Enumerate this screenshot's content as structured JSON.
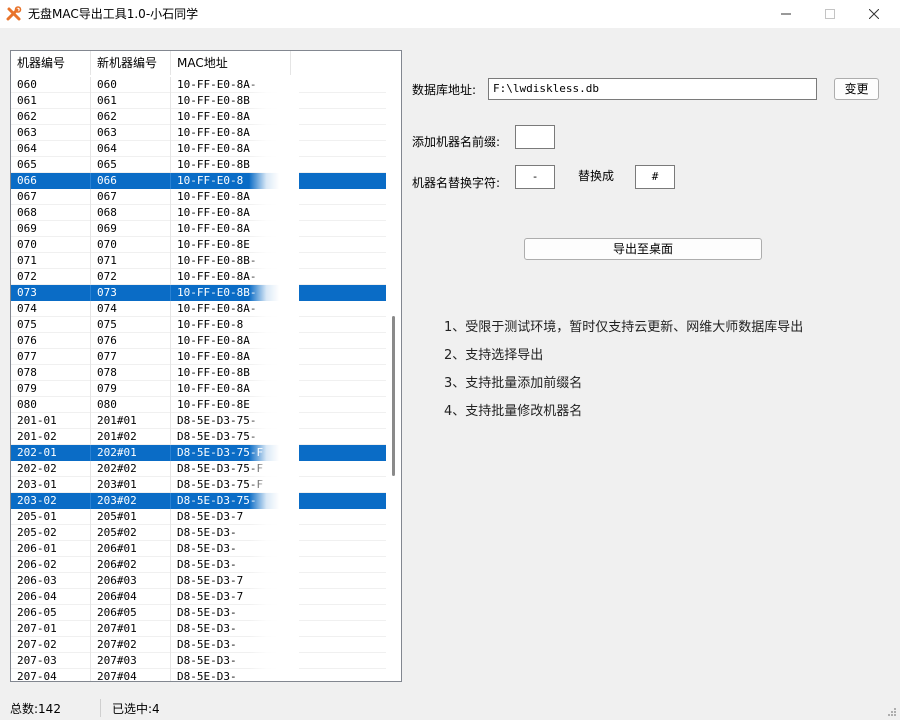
{
  "window": {
    "title": "无盘MAC导出工具1.0-小石同学",
    "controls": {
      "minimize": "—",
      "maximize": "☐",
      "close": "✕"
    }
  },
  "list": {
    "columns": [
      "机器编号",
      "新机器编号",
      "MAC地址"
    ],
    "rows": [
      {
        "id": "060",
        "new": "060",
        "mac": "10-FF-E0-8A-",
        "selected": false
      },
      {
        "id": "061",
        "new": "061",
        "mac": "10-FF-E0-8B",
        "selected": false
      },
      {
        "id": "062",
        "new": "062",
        "mac": "10-FF-E0-8A",
        "selected": false
      },
      {
        "id": "063",
        "new": "063",
        "mac": "10-FF-E0-8A",
        "selected": false
      },
      {
        "id": "064",
        "new": "064",
        "mac": "10-FF-E0-8A",
        "selected": false
      },
      {
        "id": "065",
        "new": "065",
        "mac": "10-FF-E0-8B",
        "selected": false
      },
      {
        "id": "066",
        "new": "066",
        "mac": "10-FF-E0-8",
        "selected": true
      },
      {
        "id": "067",
        "new": "067",
        "mac": "10-FF-E0-8A",
        "selected": false
      },
      {
        "id": "068",
        "new": "068",
        "mac": "10-FF-E0-8A",
        "selected": false
      },
      {
        "id": "069",
        "new": "069",
        "mac": "10-FF-E0-8A",
        "selected": false
      },
      {
        "id": "070",
        "new": "070",
        "mac": "10-FF-E0-8E",
        "selected": false
      },
      {
        "id": "071",
        "new": "071",
        "mac": "10-FF-E0-8B-",
        "selected": false
      },
      {
        "id": "072",
        "new": "072",
        "mac": "10-FF-E0-8A-",
        "selected": false
      },
      {
        "id": "073",
        "new": "073",
        "mac": "10-FF-E0-8B-",
        "selected": true
      },
      {
        "id": "074",
        "new": "074",
        "mac": "10-FF-E0-8A-",
        "selected": false
      },
      {
        "id": "075",
        "new": "075",
        "mac": "10-FF-E0-8",
        "selected": false
      },
      {
        "id": "076",
        "new": "076",
        "mac": "10-FF-E0-8A",
        "selected": false
      },
      {
        "id": "077",
        "new": "077",
        "mac": "10-FF-E0-8A",
        "selected": false
      },
      {
        "id": "078",
        "new": "078",
        "mac": "10-FF-E0-8B",
        "selected": false
      },
      {
        "id": "079",
        "new": "079",
        "mac": "10-FF-E0-8A",
        "selected": false
      },
      {
        "id": "080",
        "new": "080",
        "mac": "10-FF-E0-8E",
        "selected": false
      },
      {
        "id": "201-01",
        "new": "201#01",
        "mac": "D8-5E-D3-75-",
        "selected": false
      },
      {
        "id": "201-02",
        "new": "201#02",
        "mac": "D8-5E-D3-75-",
        "selected": false
      },
      {
        "id": "202-01",
        "new": "202#01",
        "mac": "D8-5E-D3-75-F",
        "selected": true
      },
      {
        "id": "202-02",
        "new": "202#02",
        "mac": "D8-5E-D3-75-F",
        "selected": false
      },
      {
        "id": "203-01",
        "new": "203#01",
        "mac": "D8-5E-D3-75-F",
        "selected": false
      },
      {
        "id": "203-02",
        "new": "203#02",
        "mac": "D8-5E-D3-75-",
        "selected": true
      },
      {
        "id": "205-01",
        "new": "205#01",
        "mac": "D8-5E-D3-7",
        "selected": false
      },
      {
        "id": "205-02",
        "new": "205#02",
        "mac": "D8-5E-D3-",
        "selected": false
      },
      {
        "id": "206-01",
        "new": "206#01",
        "mac": "D8-5E-D3-",
        "selected": false
      },
      {
        "id": "206-02",
        "new": "206#02",
        "mac": "D8-5E-D3-",
        "selected": false
      },
      {
        "id": "206-03",
        "new": "206#03",
        "mac": "D8-5E-D3-7",
        "selected": false
      },
      {
        "id": "206-04",
        "new": "206#04",
        "mac": "D8-5E-D3-7",
        "selected": false
      },
      {
        "id": "206-05",
        "new": "206#05",
        "mac": "D8-5E-D3-",
        "selected": false
      },
      {
        "id": "207-01",
        "new": "207#01",
        "mac": "D8-5E-D3-",
        "selected": false
      },
      {
        "id": "207-02",
        "new": "207#02",
        "mac": "D8-5E-D3-",
        "selected": false
      },
      {
        "id": "207-03",
        "new": "207#03",
        "mac": "D8-5E-D3-",
        "selected": false
      },
      {
        "id": "207-04",
        "new": "207#04",
        "mac": "D8-5E-D3-",
        "selected": false
      }
    ]
  },
  "form": {
    "db_label": "数据库地址:",
    "db_value": "F:\\lwdiskless.db",
    "change_button": "变更",
    "prefix_label": "添加机器名前缀:",
    "prefix_value": "",
    "replace_label": "机器名替换字符:",
    "replace_from": "-",
    "replace_to_label": "替换成",
    "replace_to": "#",
    "export_button": "导出至桌面"
  },
  "info": [
    "1、受限于测试环境，暂时仅支持云更新、网维大师数据库导出",
    "2、支持选择导出",
    "3、支持批量添加前缀名",
    "4、支持批量修改机器名"
  ],
  "status": {
    "total": "总数:142",
    "selected": "已选中:4"
  },
  "colors": {
    "selection": "#0a6cc6",
    "window_bg": "#f0f0f0",
    "icon_orange": "#e8732a"
  }
}
